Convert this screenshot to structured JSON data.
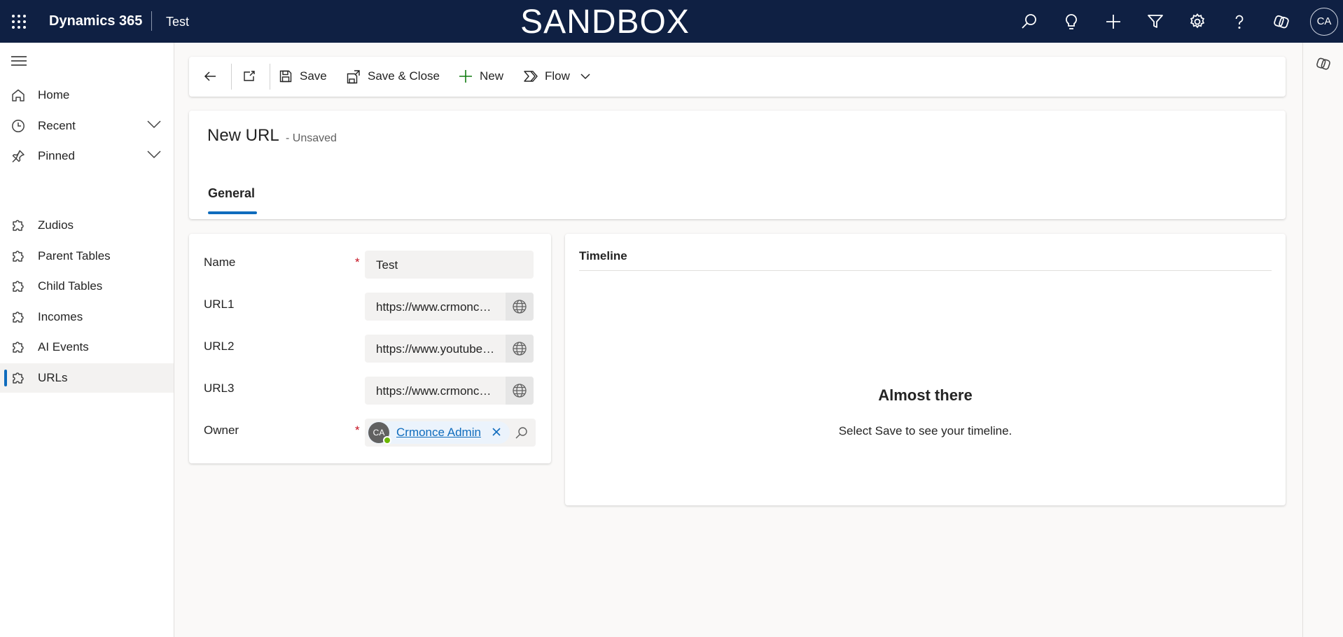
{
  "topbar": {
    "app_name": "Dynamics 365",
    "environment": "Test",
    "banner": "SANDBOX",
    "user_initials": "CA",
    "background": "#0f2043"
  },
  "nav": {
    "items": [
      {
        "label": "Home",
        "icon": "home-icon"
      },
      {
        "label": "Recent",
        "icon": "clock-icon"
      },
      {
        "label": "Pinned",
        "icon": "pin-icon"
      },
      {
        "label": "Zudios",
        "icon": "puzzle-icon"
      },
      {
        "label": "Parent Tables",
        "icon": "puzzle-icon"
      },
      {
        "label": "Child Tables",
        "icon": "puzzle-icon"
      },
      {
        "label": "Incomes",
        "icon": "puzzle-icon"
      },
      {
        "label": "AI Events",
        "icon": "puzzle-icon"
      },
      {
        "label": "URLs",
        "icon": "puzzle-icon",
        "selected": true
      }
    ]
  },
  "commands": {
    "save": "Save",
    "save_close": "Save & Close",
    "new": "New",
    "flow": "Flow"
  },
  "record": {
    "title": "New URL",
    "status": "- Unsaved",
    "tabs": [
      "General"
    ]
  },
  "form": {
    "fields": [
      {
        "label": "Name",
        "value": "Test",
        "required": true
      },
      {
        "label": "URL1",
        "value": "https://www.crmonce.com"
      },
      {
        "label": "URL2",
        "value": "https://www.youtube.com"
      },
      {
        "label": "URL3",
        "value": "https://www.crmonce.com"
      }
    ],
    "owner": {
      "label": "Owner",
      "initials": "CA",
      "name": "Crmonce Admin",
      "required": true
    }
  },
  "timeline": {
    "title": "Timeline",
    "empty_title": "Almost there",
    "empty_subtitle": "Select Save to see your timeline."
  },
  "colors": {
    "accent": "#0f6cbd",
    "required": "#c50f1f",
    "presence": "#6bb700"
  }
}
